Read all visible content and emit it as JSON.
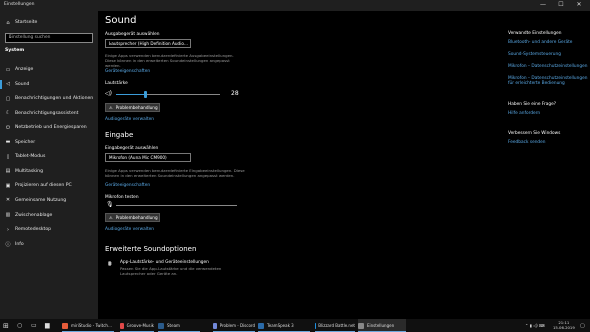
{
  "window": {
    "title": "Einstellungen",
    "min": "—",
    "max": "☐",
    "close": "✕"
  },
  "sidebar": {
    "home_label": "Startseite",
    "search_placeholder": "Einstellung suchen",
    "section_label": "System",
    "items": [
      {
        "label": "Anzeige",
        "icon": "display-icon",
        "glyph": "▭"
      },
      {
        "label": "Sound",
        "icon": "speaker-icon",
        "glyph": "◁",
        "active": true
      },
      {
        "label": "Benachrichtigungen und Aktionen",
        "icon": "notification-icon",
        "glyph": "▢"
      },
      {
        "label": "Benachrichtigungsassistent",
        "icon": "moon-icon",
        "glyph": "☾"
      },
      {
        "label": "Netzbetrieb und Energiesparen",
        "icon": "power-icon",
        "glyph": "⏻"
      },
      {
        "label": "Speicher",
        "icon": "storage-icon",
        "glyph": "▬"
      },
      {
        "label": "Tablet-Modus",
        "icon": "tablet-icon",
        "glyph": "▯"
      },
      {
        "label": "Multitasking",
        "icon": "multitasking-icon",
        "glyph": "▤"
      },
      {
        "label": "Projizieren auf diesen PC",
        "icon": "project-icon",
        "glyph": "▣"
      },
      {
        "label": "Gemeinsame Nutzung",
        "icon": "share-icon",
        "glyph": "✕"
      },
      {
        "label": "Zwischenablage",
        "icon": "clipboard-icon",
        "glyph": "▥"
      },
      {
        "label": "Remotedesktop",
        "icon": "remote-desktop-icon",
        "glyph": "›"
      },
      {
        "label": "Info",
        "icon": "info-icon",
        "glyph": "ⓘ"
      }
    ]
  },
  "main": {
    "title": "Sound",
    "output": {
      "select_label": "Ausgabegerät auswählen",
      "selected_device": "Lautsprecher (High Definition Audio…",
      "description": "Einige Apps verwenden benutzerdefinierte Ausgabeeinstellungen. Diese können in den erweiterten Soundeinstellungen angepasst werden.",
      "properties_link": "Geräteeigenschaften",
      "volume_label": "Lautstärke",
      "volume_value": "28",
      "volume_fraction": 0.28,
      "troubleshoot_button": "Problembehandlung",
      "manage_link": "Audiogeräte verwalten"
    },
    "input": {
      "heading": "Eingabe",
      "select_label": "Eingabegerät auswählen",
      "selected_device": "Mikrofon (Auna Mic CM900)",
      "description": "Einige Apps verwenden benutzerdefinierte Eingabeeinstellungen. Diese können in den erweiterten Soundeinstellungen angepasst werden.",
      "properties_link": "Geräteeigenschaften",
      "test_label": "Mikrofon testen",
      "troubleshoot_button": "Problembehandlung",
      "manage_link": "Audiogeräte verwalten"
    },
    "advanced": {
      "heading": "Erweiterte Soundoptionen",
      "app_volume_title": "App-Lautstärke- und Geräteeinstellungen",
      "app_volume_desc": "Passen Sie die App-Lautstärke und die verwendeten Lautsprecher oder Geräte an."
    }
  },
  "right": {
    "related_heading": "Verwandte Einstellungen",
    "related_links": [
      "Bluetooth- und andere Geräte",
      "Sound-Systemsteuerung",
      "Mikrofon – Datenschutzeinstellungen",
      "Mikrofon – Datenschutzeinstellungen für erleichterte Bedienung"
    ],
    "question_heading": "Haben Sie eine Frage?",
    "help_link": "Hilfe anfordern",
    "improve_heading": "Verbessern Sie Windows",
    "feedback_link": "Feedback senden"
  },
  "taskbar": {
    "apps": [
      {
        "label": "miriStudio - Twitch…",
        "color": "#e65c3a"
      },
      {
        "label": "Groove-Musik",
        "color": "#e04848"
      },
      {
        "label": "Steam",
        "color": "#2a5a8a"
      },
      {
        "label": "Problem - Discord",
        "color": "#7289da"
      },
      {
        "label": "TeamSpeak 3",
        "color": "#2a6aa8"
      },
      {
        "label": "Blizzard Battle.net",
        "color": "#1d8fe0"
      },
      {
        "label": "Einstellungen",
        "color": "#888888"
      }
    ],
    "time": "21:11",
    "date": "15.06.2019"
  }
}
